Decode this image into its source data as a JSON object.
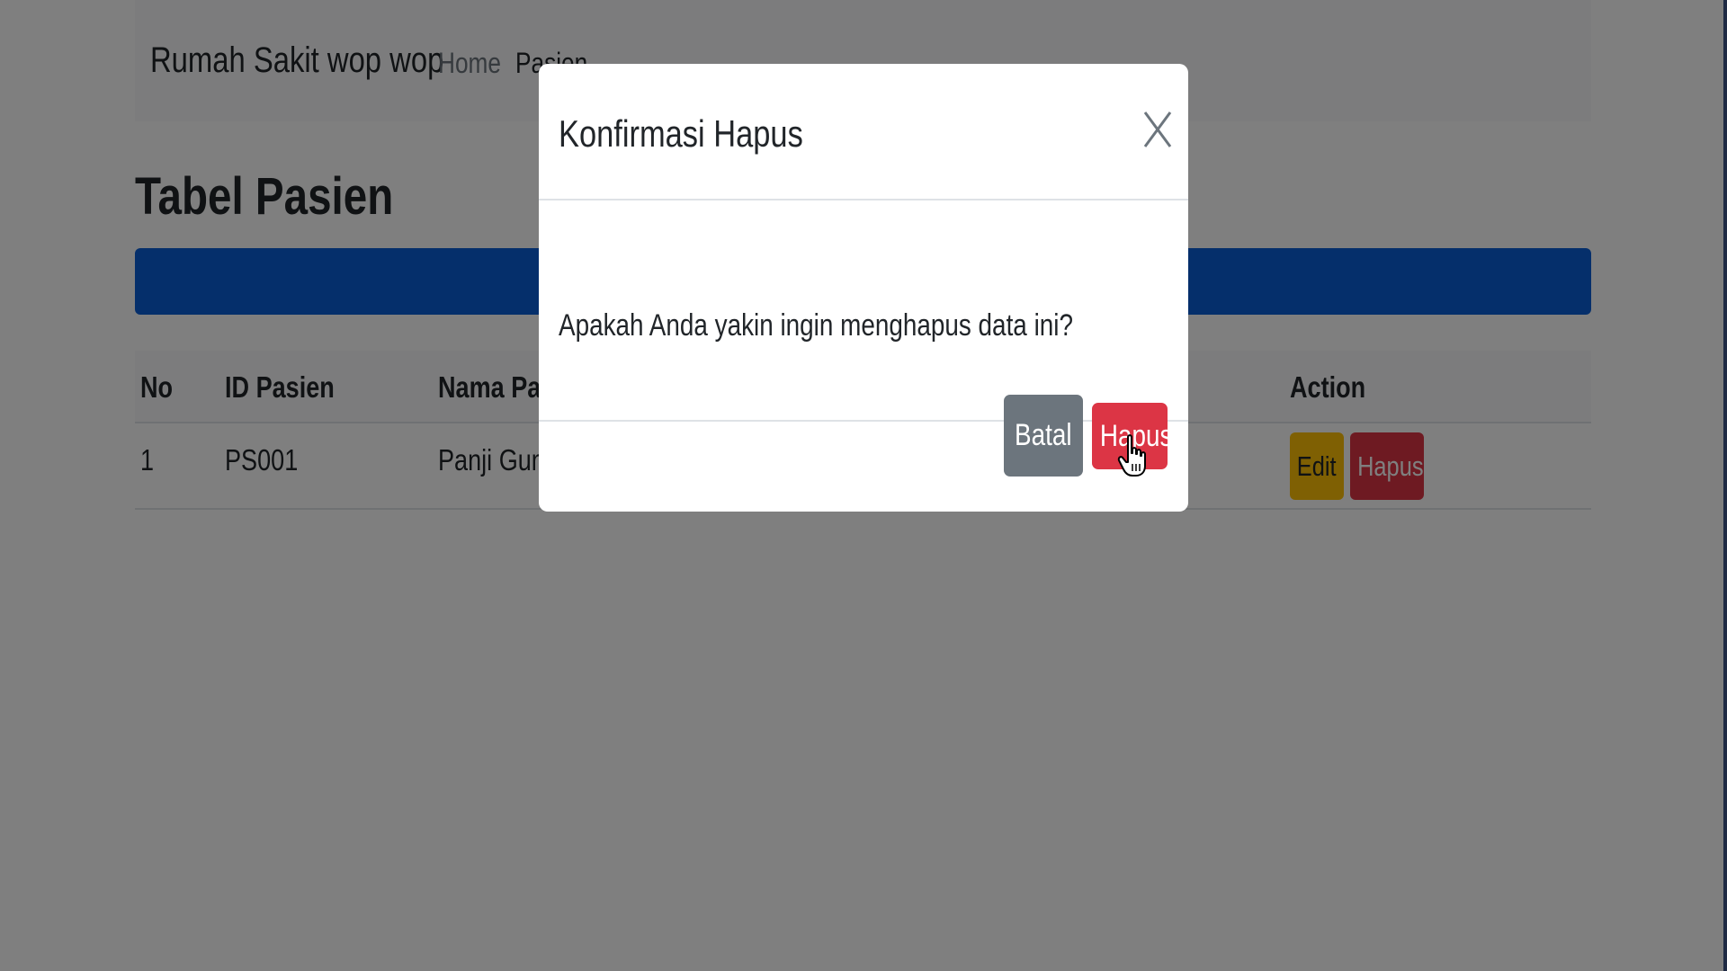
{
  "navbar": {
    "brand": "Rumah Sakit wop wop",
    "links": [
      {
        "label": "Home",
        "active": false
      },
      {
        "label": "Pasien",
        "active": true
      }
    ]
  },
  "main": {
    "title": "Tabel Pasien",
    "table": {
      "headers": [
        "No",
        "ID Pasien",
        "Nama Pasi",
        "Action"
      ],
      "rows": [
        {
          "no": "1",
          "id": "PS001",
          "nama": "Panji Gumi",
          "edit_label": "Edit",
          "delete_label": "Hapus"
        }
      ]
    }
  },
  "modal": {
    "title": "Konfirmasi Hapus",
    "close_label": "X",
    "message": "Apakah Anda yakin ingin menghapus data ini?",
    "cancel_label": "Batal",
    "confirm_label": "Hapus"
  },
  "colors": {
    "primary": "#0b5ed7",
    "danger": "#dc3545",
    "warning": "#ffc107",
    "secondary": "#6c757d"
  },
  "icons": {
    "cursor": "hand-pointer-icon"
  }
}
